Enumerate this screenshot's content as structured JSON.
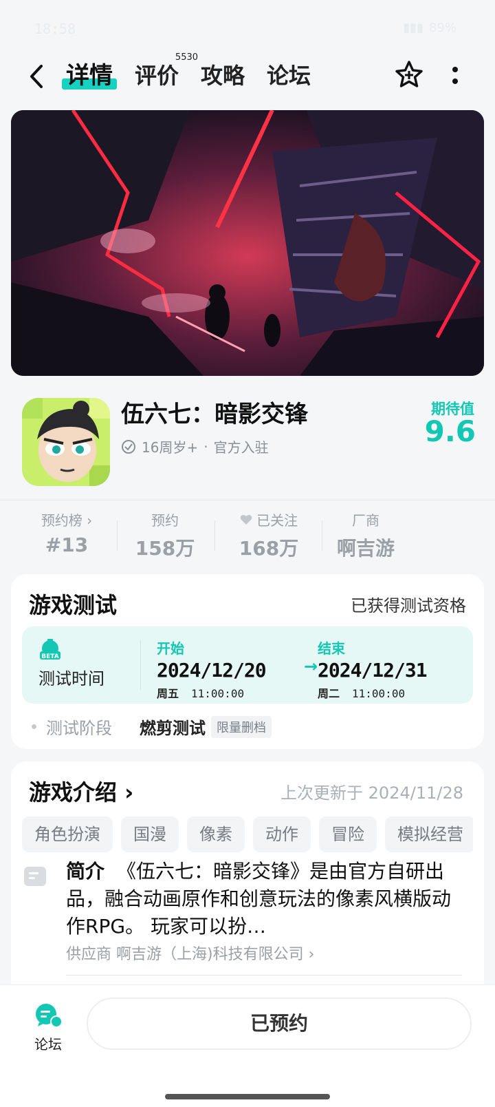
{
  "status_bar": {
    "time": "18:58",
    "right": "89%"
  },
  "header": {
    "tabs": [
      {
        "label": "详情",
        "active": true
      },
      {
        "label": "评价",
        "badge": "5530"
      },
      {
        "label": "攻略"
      },
      {
        "label": "论坛"
      }
    ],
    "icons": [
      "back-icon",
      "star-add-icon",
      "more-icon"
    ]
  },
  "game": {
    "title": "伍六七：暗影交锋",
    "age": "16周岁+",
    "official": "官方入驻",
    "expect_label": "期待值",
    "expect_value": "9.6"
  },
  "stats": [
    {
      "label": "预约榜 ›",
      "value": "#13"
    },
    {
      "label": "预约",
      "value": "158万"
    },
    {
      "label": "已关注",
      "value": "168万"
    },
    {
      "label": "厂商",
      "value": "啊吉游"
    }
  ],
  "test": {
    "title": "游戏测试",
    "status": "已获得测试资格",
    "time_label": "测试时间",
    "beta_icon_text": "BETA",
    "start_label": "开始",
    "start_date": "2024/12/20",
    "start_weekday": "周五",
    "start_time": "11:00:00",
    "end_label": "结束",
    "end_date": "2024/12/31",
    "end_weekday": "周二",
    "end_time": "11:00:00",
    "arrow": "→",
    "stage_label": "测试阶段",
    "stage_value": "燃剪测试",
    "stage_tag": "限量删档"
  },
  "intro": {
    "title": "游戏介绍 ›",
    "updated": "上次更新于 2024/11/28",
    "tags": [
      "角色扮演",
      "国漫",
      "像素",
      "动作",
      "冒险",
      "模拟经营"
    ],
    "label": "简介",
    "text": "《伍六七：暗影交锋》是由官方自研出品，融合动画原作和创意玩法的像素风横版动作RPG。 玩家可以扮…",
    "supplier": "供应商  啊吉游（上海)科技有限公司 ›"
  },
  "bottom": {
    "forum_label": "论坛",
    "reserve_label": "已预约"
  },
  "colors": {
    "accent": "#12c7b4",
    "accent_bg": "#e6f8f6"
  }
}
